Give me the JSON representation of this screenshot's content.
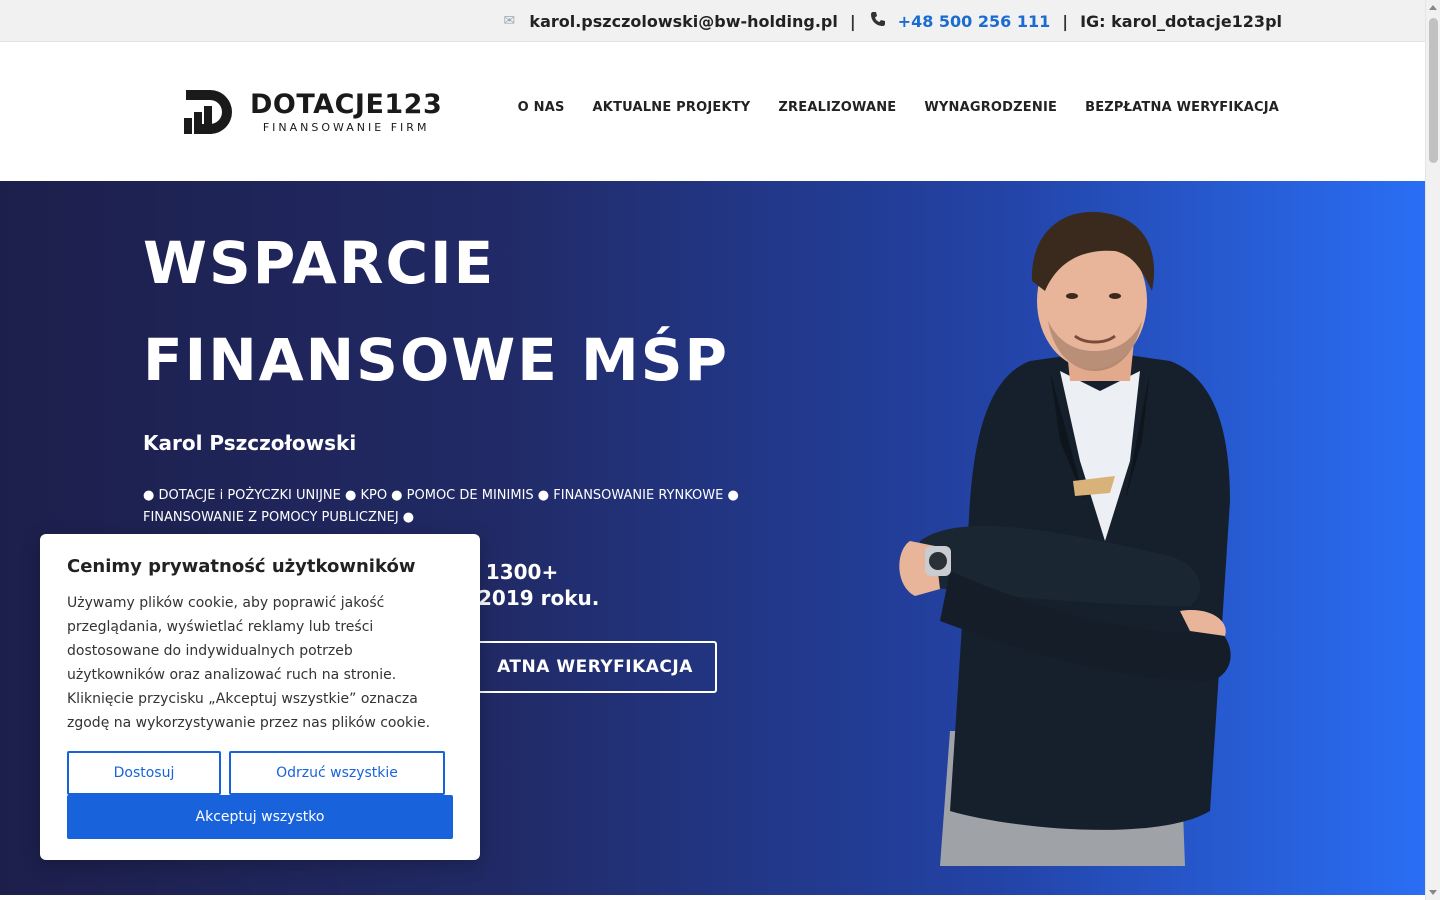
{
  "topbar": {
    "email": "karol.pszczolowski@bw-holding.pl",
    "separator": "|",
    "phone": "+48 500 256 111",
    "instagram": "IG: karol_dotacje123pl",
    "email_icon": "mail-icon",
    "phone_icon": "phone-icon"
  },
  "header": {
    "logo_title": "DOTACJE123",
    "logo_subtitle": "FINANSOWANIE FIRM",
    "nav": [
      {
        "label": "O NAS"
      },
      {
        "label": "AKTUALNE PROJEKTY"
      },
      {
        "label": "ZREALIZOWANE"
      },
      {
        "label": "WYNAGRODZENIE"
      },
      {
        "label": "BEZPŁATNA WERYFIKACJA"
      }
    ]
  },
  "hero": {
    "title_line1": "WSPARCIE",
    "title_line2": "FINANSOWE MŚP",
    "name": "Karol Pszczołowski",
    "services_line1": "● DOTACJE i POŻYCZKI UNIJNE ● KPO ● POMOC DE MINIMIS ● FINANSOWANIE RYNKOWE ●",
    "services_line2": "FINANSOWANIE Z POMOCY PUBLICZNEJ ●",
    "stats_line1": "ad 1300+",
    "stats_line2": "2019 roku.",
    "cta": "ATNA WERYFIKACJA"
  },
  "cookie": {
    "title": "Cenimy prywatność użytkowników",
    "text": "Używamy plików cookie, aby poprawić jakość przeglądania, wyświetlać reklamy lub treści dostosowane do indywidualnych potrzeb użytkowników oraz analizować ruch na stronie. Kliknięcie przycisku „Akceptuj wszystkie” oznacza zgodę na wykorzystywanie przez nas plików cookie.",
    "customize": "Dostosuj",
    "reject": "Odrzuć wszystkie",
    "accept": "Akceptuj wszystko"
  },
  "colors": {
    "accent": "#1863dc",
    "phone_link": "#1a6cd0",
    "hero_start": "#1d1f4b",
    "hero_end": "#2a6ef5"
  }
}
